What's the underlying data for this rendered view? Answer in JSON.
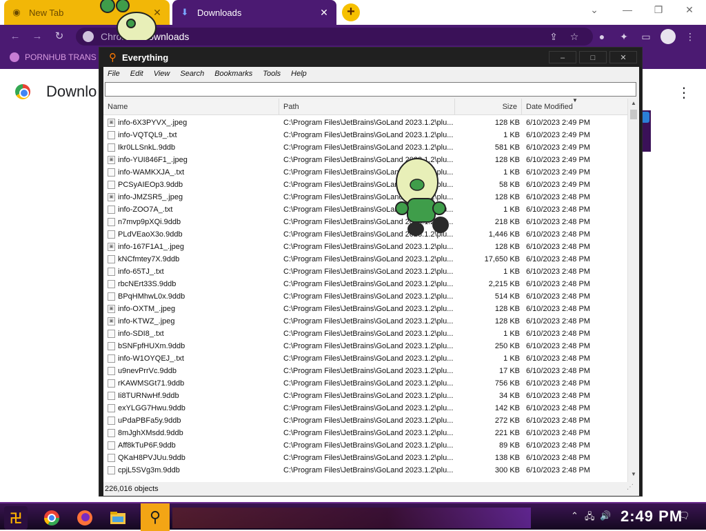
{
  "chrome": {
    "tabs": [
      {
        "label": "New Tab",
        "icon": "chrome-icon",
        "active": false
      },
      {
        "label": "Downloads",
        "icon": "download-icon",
        "active": true
      }
    ],
    "address": {
      "scheme": "Chrome",
      "rest": "://downloads"
    },
    "bookmark": {
      "label": "PORNHUB TRANS"
    },
    "page_title": "Downlo",
    "accent_color": "#4b1a72"
  },
  "everything": {
    "title": "Everything",
    "menu": [
      "File",
      "Edit",
      "View",
      "Search",
      "Bookmarks",
      "Tools",
      "Help"
    ],
    "search_value": "",
    "columns": {
      "name": "Name",
      "path": "Path",
      "size": "Size",
      "date": "Date Modified"
    },
    "rows": [
      {
        "name": "info-6X3PYVX_.jpeg",
        "path": "C:\\Program Files\\JetBrains\\GoLand 2023.1.2\\plu...",
        "size": "128 KB",
        "date": "6/10/2023 2:49 PM",
        "type": "image"
      },
      {
        "name": "info-VQTQL9_.txt",
        "path": "C:\\Program Files\\JetBrains\\GoLand 2023.1.2\\plu...",
        "size": "1 KB",
        "date": "6/10/2023 2:49 PM",
        "type": "file"
      },
      {
        "name": "Ikr0LLSnkL.9ddb",
        "path": "C:\\Program Files\\JetBrains\\GoLand 2023.1.2\\plu...",
        "size": "581 KB",
        "date": "6/10/2023 2:49 PM",
        "type": "file"
      },
      {
        "name": "info-YUI846F1_.jpeg",
        "path": "C:\\Program Files\\JetBrains\\GoLand 2023.1.2\\plu...",
        "size": "128 KB",
        "date": "6/10/2023 2:49 PM",
        "type": "image"
      },
      {
        "name": "info-WAMKXJA_.txt",
        "path": "C:\\Program Files\\JetBrains\\GoLand 2023.1.2\\plu...",
        "size": "1 KB",
        "date": "6/10/2023 2:49 PM",
        "type": "file"
      },
      {
        "name": "PCSyAIEOp3.9ddb",
        "path": "C:\\Program Files\\JetBrains\\GoLand 2023.1.2\\plu...",
        "size": "58 KB",
        "date": "6/10/2023 2:49 PM",
        "type": "file"
      },
      {
        "name": "info-JMZSR5_.jpeg",
        "path": "C:\\Program Files\\JetBrains\\GoLand 2023.1.2\\plu...",
        "size": "128 KB",
        "date": "6/10/2023 2:48 PM",
        "type": "image"
      },
      {
        "name": "info-ZOO7A_.txt",
        "path": "C:\\Program Files\\JetBrains\\GoLand 2023.1.2\\plu...",
        "size": "1 KB",
        "date": "6/10/2023 2:48 PM",
        "type": "file"
      },
      {
        "name": "n7mvp9pXQi.9ddb",
        "path": "C:\\Program Files\\JetBrains\\GoLand 2023.1.2\\plu...",
        "size": "218 KB",
        "date": "6/10/2023 2:48 PM",
        "type": "file"
      },
      {
        "name": "PLdVEaoX3o.9ddb",
        "path": "C:\\Program Files\\JetBrains\\GoLand 2023.1.2\\plu...",
        "size": "1,446 KB",
        "date": "6/10/2023 2:48 PM",
        "type": "file"
      },
      {
        "name": "info-167F1A1_.jpeg",
        "path": "C:\\Program Files\\JetBrains\\GoLand 2023.1.2\\plu...",
        "size": "128 KB",
        "date": "6/10/2023 2:48 PM",
        "type": "image"
      },
      {
        "name": "kNCfmtey7X.9ddb",
        "path": "C:\\Program Files\\JetBrains\\GoLand 2023.1.2\\plu...",
        "size": "17,650 KB",
        "date": "6/10/2023 2:48 PM",
        "type": "file"
      },
      {
        "name": "info-65TJ_.txt",
        "path": "C:\\Program Files\\JetBrains\\GoLand 2023.1.2\\plu...",
        "size": "1 KB",
        "date": "6/10/2023 2:48 PM",
        "type": "file"
      },
      {
        "name": "rbcNErt33S.9ddb",
        "path": "C:\\Program Files\\JetBrains\\GoLand 2023.1.2\\plu...",
        "size": "2,215 KB",
        "date": "6/10/2023 2:48 PM",
        "type": "file"
      },
      {
        "name": "BPqHMhwL0x.9ddb",
        "path": "C:\\Program Files\\JetBrains\\GoLand 2023.1.2\\plu...",
        "size": "514 KB",
        "date": "6/10/2023 2:48 PM",
        "type": "file"
      },
      {
        "name": "info-OXTM_.jpeg",
        "path": "C:\\Program Files\\JetBrains\\GoLand 2023.1.2\\plu...",
        "size": "128 KB",
        "date": "6/10/2023 2:48 PM",
        "type": "image"
      },
      {
        "name": "info-KTWZ_.jpeg",
        "path": "C:\\Program Files\\JetBrains\\GoLand 2023.1.2\\plu...",
        "size": "128 KB",
        "date": "6/10/2023 2:48 PM",
        "type": "image"
      },
      {
        "name": "info-SDI8_.txt",
        "path": "C:\\Program Files\\JetBrains\\GoLand 2023.1.2\\plu...",
        "size": "1 KB",
        "date": "6/10/2023 2:48 PM",
        "type": "file"
      },
      {
        "name": "bSNFpfHUXm.9ddb",
        "path": "C:\\Program Files\\JetBrains\\GoLand 2023.1.2\\plu...",
        "size": "250 KB",
        "date": "6/10/2023 2:48 PM",
        "type": "file"
      },
      {
        "name": "info-W1OYQEJ_.txt",
        "path": "C:\\Program Files\\JetBrains\\GoLand 2023.1.2\\plu...",
        "size": "1 KB",
        "date": "6/10/2023 2:48 PM",
        "type": "file"
      },
      {
        "name": "u9nevPrrVc.9ddb",
        "path": "C:\\Program Files\\JetBrains\\GoLand 2023.1.2\\plu...",
        "size": "17 KB",
        "date": "6/10/2023 2:48 PM",
        "type": "file"
      },
      {
        "name": "rKAWMSGt71.9ddb",
        "path": "C:\\Program Files\\JetBrains\\GoLand 2023.1.2\\plu...",
        "size": "756 KB",
        "date": "6/10/2023 2:48 PM",
        "type": "file"
      },
      {
        "name": "Ii8TURNwHf.9ddb",
        "path": "C:\\Program Files\\JetBrains\\GoLand 2023.1.2\\plu...",
        "size": "34 KB",
        "date": "6/10/2023 2:48 PM",
        "type": "file"
      },
      {
        "name": "exYLGG7Hwu.9ddb",
        "path": "C:\\Program Files\\JetBrains\\GoLand 2023.1.2\\plu...",
        "size": "142 KB",
        "date": "6/10/2023 2:48 PM",
        "type": "file"
      },
      {
        "name": "uPdaPBFa5y.9ddb",
        "path": "C:\\Program Files\\JetBrains\\GoLand 2023.1.2\\plu...",
        "size": "272 KB",
        "date": "6/10/2023 2:48 PM",
        "type": "file"
      },
      {
        "name": "8mJghXMsdd.9ddb",
        "path": "C:\\Program Files\\JetBrains\\GoLand 2023.1.2\\plu...",
        "size": "221 KB",
        "date": "6/10/2023 2:48 PM",
        "type": "file"
      },
      {
        "name": "Aff8kTuP6F.9ddb",
        "path": "C:\\Program Files\\JetBrains\\GoLand 2023.1.2\\plu...",
        "size": "89 KB",
        "date": "6/10/2023 2:48 PM",
        "type": "file"
      },
      {
        "name": "QKaH8PVJUu.9ddb",
        "path": "C:\\Program Files\\JetBrains\\GoLand 2023.1.2\\plu...",
        "size": "138 KB",
        "date": "6/10/2023 2:48 PM",
        "type": "file"
      },
      {
        "name": "cpjL5SVg3m.9ddb",
        "path": "C:\\Program Files\\JetBrains\\GoLand 2023.1.2\\plu...",
        "size": "300 KB",
        "date": "6/10/2023 2:48 PM",
        "type": "file"
      }
    ],
    "status": "226,016 objects"
  },
  "taskbar": {
    "clock": "2:49 PM",
    "items": [
      "start-icon",
      "chrome-icon",
      "firefox-icon",
      "file-explorer-icon",
      "everything-search-icon"
    ]
  }
}
